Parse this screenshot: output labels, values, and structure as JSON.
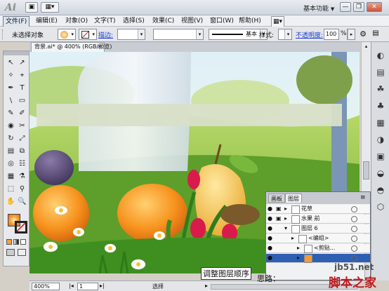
{
  "app": {
    "logo": "Ai",
    "workspace": "基本功能",
    "workspace_arrow": "▼"
  },
  "titlebar_icons": [
    "▣",
    "▦▾"
  ],
  "window_controls": {
    "minimize": "—",
    "restore": "❐",
    "close": "✕"
  },
  "menu": [
    "文件(F)",
    "编辑(E)",
    "对象(O)",
    "文字(T)",
    "选择(S)",
    "效果(C)",
    "视图(V)",
    "窗口(W)",
    "帮助(H)"
  ],
  "menu_extra": "▦▾",
  "controlbar": {
    "selection": "未选择对象",
    "stroke_label": "描边:",
    "stroke_style": "基本",
    "style_label": "样式:",
    "opacity_label": "不透明度:",
    "opacity_value": "100",
    "opacity_unit": "%"
  },
  "document_tab": "背景.ai* @ 400% (RGB/预览)",
  "tab_close": "×",
  "layers_panel": {
    "tabs": [
      "画板",
      "图层"
    ],
    "rows": [
      {
        "name": "花草"
      },
      {
        "name": "水果 前"
      },
      {
        "name": "图层 6"
      },
      {
        "name": "<编组>"
      },
      {
        "name": "<剪贴..."
      },
      {
        "name": ""
      }
    ]
  },
  "status": {
    "zoom": "400%",
    "page": "1",
    "mode": "选择"
  },
  "callout": "调整图层顺序",
  "callout2": "思路：",
  "watermark": {
    "site": "jb51.net",
    "brand": "脚本之家"
  },
  "tools": [
    "↖",
    "↗",
    "✧",
    "⌖",
    "✒",
    "T",
    "\\",
    "▭",
    "✎",
    "✐",
    "◉",
    "✂",
    "↻",
    "⤢",
    "▤",
    "⧉",
    "◎",
    "☷",
    "▦",
    "⚗",
    "⬚",
    "⚲",
    "✋",
    "🔍"
  ],
  "dock_icons": [
    "◐",
    "▤",
    "☘",
    "♣",
    "▦",
    "◑",
    "▣",
    "◒",
    "◓",
    "⬡"
  ]
}
